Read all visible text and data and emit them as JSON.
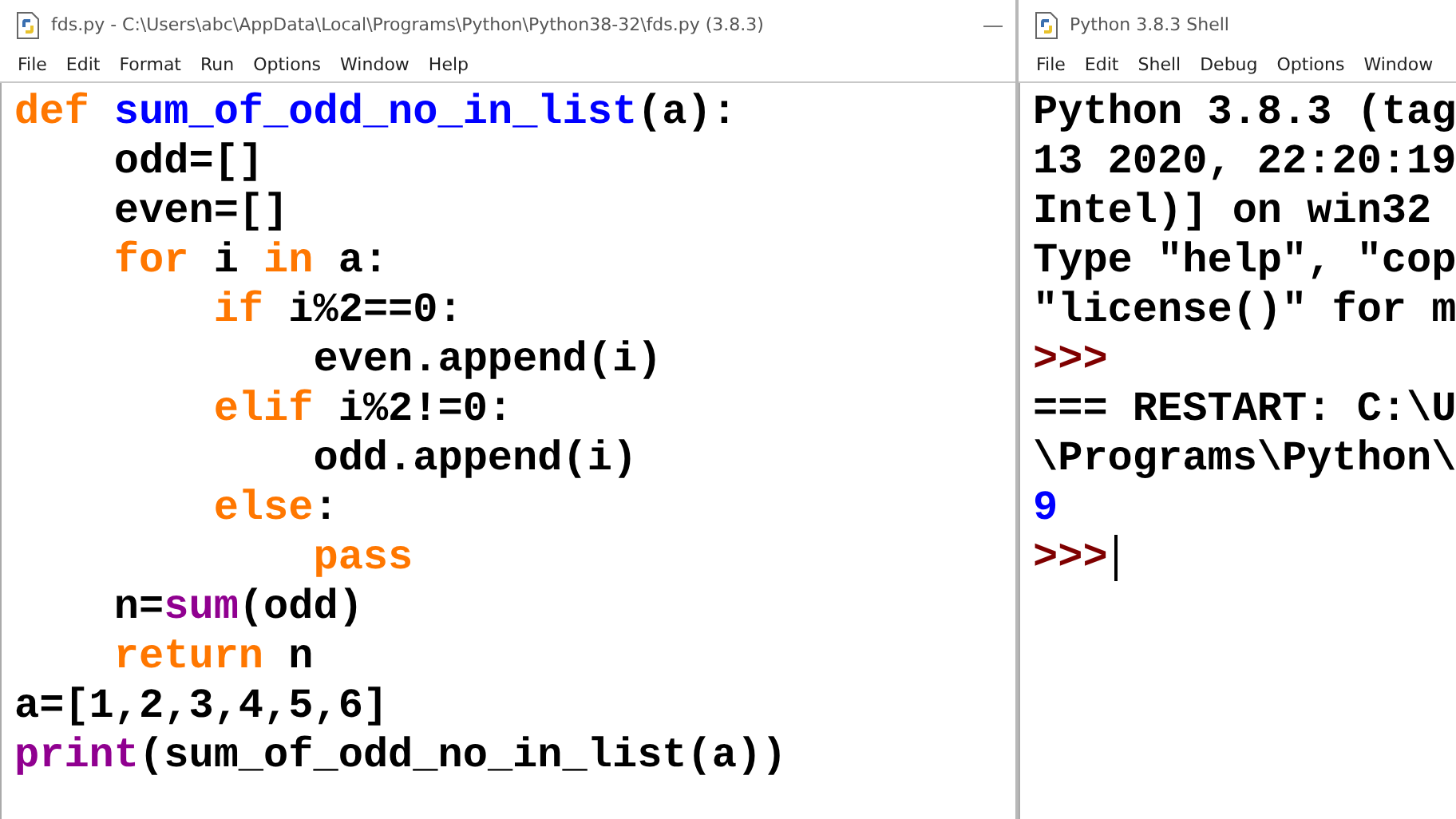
{
  "editor": {
    "window": {
      "title": "fds.py - C:\\Users\\abc\\AppData\\Local\\Programs\\Python\\Python38-32\\fds.py (3.8.3)"
    },
    "menu": [
      "File",
      "Edit",
      "Format",
      "Run",
      "Options",
      "Window",
      "Help"
    ],
    "lines": [
      {
        "tokens": [
          {
            "kind": "keyword",
            "text": "def "
          },
          {
            "kind": "defname",
            "text": "sum_of_odd_no_in_list"
          },
          {
            "kind": "plain",
            "text": "(a):"
          }
        ],
        "children": [
          {
            "tokens": [
              {
                "kind": "plain",
                "text": "odd=[]"
              }
            ]
          },
          {
            "tokens": [
              {
                "kind": "plain",
                "text": "even=[]"
              }
            ]
          },
          {
            "tokens": [
              {
                "kind": "keyword",
                "text": "for"
              },
              {
                "kind": "plain",
                "text": " i "
              },
              {
                "kind": "keyword",
                "text": "in"
              },
              {
                "kind": "plain",
                "text": " a:"
              }
            ],
            "children": [
              {
                "tokens": [
                  {
                    "kind": "keyword",
                    "text": "if"
                  },
                  {
                    "kind": "plain",
                    "text": " i%2==0:"
                  }
                ],
                "children": [
                  {
                    "tokens": [
                      {
                        "kind": "plain",
                        "text": "even.append(i)"
                      }
                    ]
                  }
                ]
              },
              {
                "tokens": [
                  {
                    "kind": "keyword",
                    "text": "elif"
                  },
                  {
                    "kind": "plain",
                    "text": " i%2!=0:"
                  }
                ],
                "children": [
                  {
                    "tokens": [
                      {
                        "kind": "plain",
                        "text": "odd.append(i)"
                      }
                    ]
                  }
                ]
              },
              {
                "tokens": [
                  {
                    "kind": "keyword",
                    "text": "else"
                  },
                  {
                    "kind": "plain",
                    "text": ":"
                  }
                ],
                "children": [
                  {
                    "tokens": [
                      {
                        "kind": "keyword",
                        "text": "pass"
                      }
                    ]
                  }
                ]
              }
            ]
          },
          {
            "tokens": [
              {
                "kind": "plain",
                "text": "n="
              },
              {
                "kind": "builtin",
                "text": "sum"
              },
              {
                "kind": "plain",
                "text": "(odd)"
              }
            ]
          },
          {
            "tokens": [
              {
                "kind": "keyword",
                "text": "return"
              },
              {
                "kind": "plain",
                "text": " n"
              }
            ]
          }
        ]
      },
      {
        "tokens": [
          {
            "kind": "plain",
            "text": "a=[1,2,3,4,5,6]"
          }
        ]
      },
      {
        "tokens": [
          {
            "kind": "builtin",
            "text": "print"
          },
          {
            "kind": "plain",
            "text": "(sum_of_odd_no_in_list(a))"
          }
        ]
      }
    ]
  },
  "shell": {
    "window": {
      "title": "Python 3.8.3 Shell"
    },
    "menu": [
      "File",
      "Edit",
      "Shell",
      "Debug",
      "Options",
      "Window"
    ],
    "lines": [
      {
        "kind": "plain",
        "text": "Python 3.8.3 (tag"
      },
      {
        "kind": "plain",
        "text": "13 2020, 22:20:19"
      },
      {
        "kind": "plain",
        "text": "Intel)] on win32"
      },
      {
        "kind": "plain",
        "text": "Type \"help\", \"cop"
      },
      {
        "kind": "plain",
        "text": "\"license()\" for m"
      },
      {
        "kind": "prompt",
        "text": ">>>"
      },
      {
        "kind": "plain",
        "text": "=== RESTART: C:\\U"
      },
      {
        "kind": "plain",
        "text": "\\Programs\\Python\\"
      },
      {
        "kind": "stdout",
        "text": "9"
      },
      {
        "kind": "prompt",
        "text": ">>>",
        "cursor": true
      }
    ]
  }
}
